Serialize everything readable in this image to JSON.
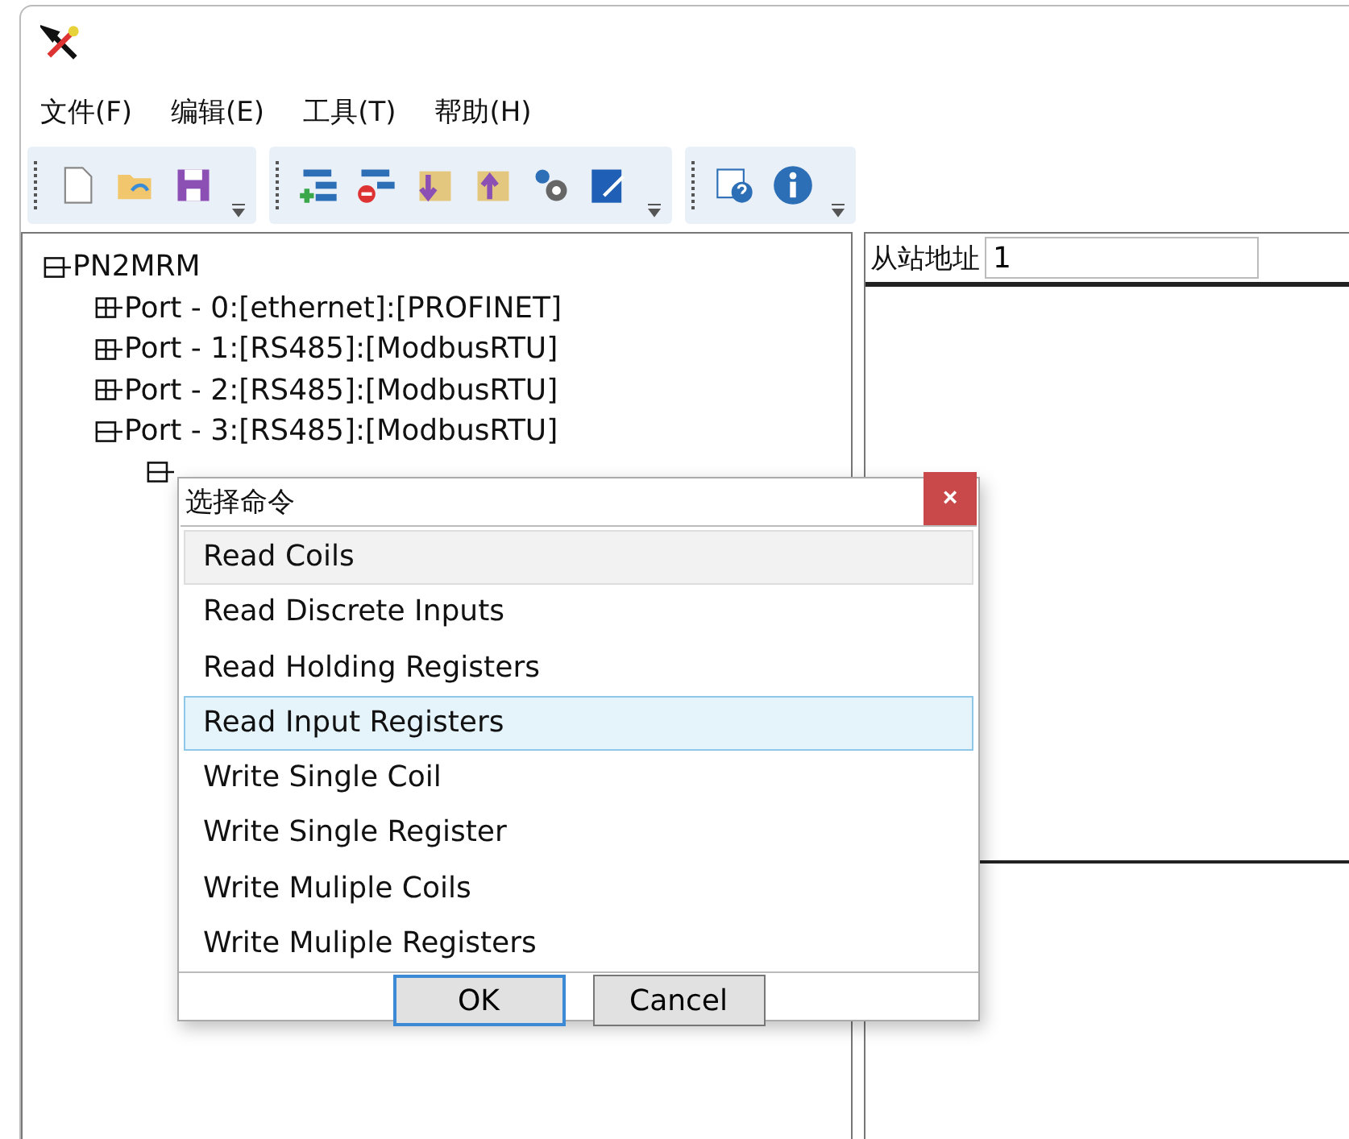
{
  "menu": [
    "文件(F)",
    "编辑(E)",
    "工具(T)",
    "帮助(H)"
  ],
  "tree": {
    "label": "PN2MRM",
    "expanded": true,
    "children": [
      {
        "label": "Port - 0:[ethernet]:[PROFINET]",
        "expanded": false
      },
      {
        "label": "Port - 1:[RS485]:[ModbusRTU]",
        "expanded": false
      },
      {
        "label": "Port - 2:[RS485]:[ModbusRTU]",
        "expanded": false
      },
      {
        "label": "Port - 3:[RS485]:[ModbusRTU]",
        "expanded": true,
        "children": [
          {
            "expanded": true
          }
        ]
      }
    ]
  },
  "slave_address": {
    "label": "从站地址",
    "value": "1"
  },
  "dialog": {
    "title": "选择命令",
    "close": "×",
    "commands": [
      {
        "label": "Read Coils",
        "selected": false,
        "hovered": true
      },
      {
        "label": "Read Discrete Inputs",
        "selected": false,
        "hovered": false
      },
      {
        "label": "Read Holding Registers",
        "selected": false,
        "hovered": false
      },
      {
        "label": "Read Input Registers",
        "selected": true,
        "hovered": false
      },
      {
        "label": "Write Single Coil",
        "selected": false,
        "hovered": false
      },
      {
        "label": "Write Single Register",
        "selected": false,
        "hovered": false
      },
      {
        "label": "Write Muliple Coils",
        "selected": false,
        "hovered": false
      },
      {
        "label": "Write Muliple Registers",
        "selected": false,
        "hovered": false
      }
    ],
    "buttons": [
      {
        "label": "OK",
        "default": true
      },
      {
        "label": "Cancel",
        "default": false
      }
    ]
  }
}
